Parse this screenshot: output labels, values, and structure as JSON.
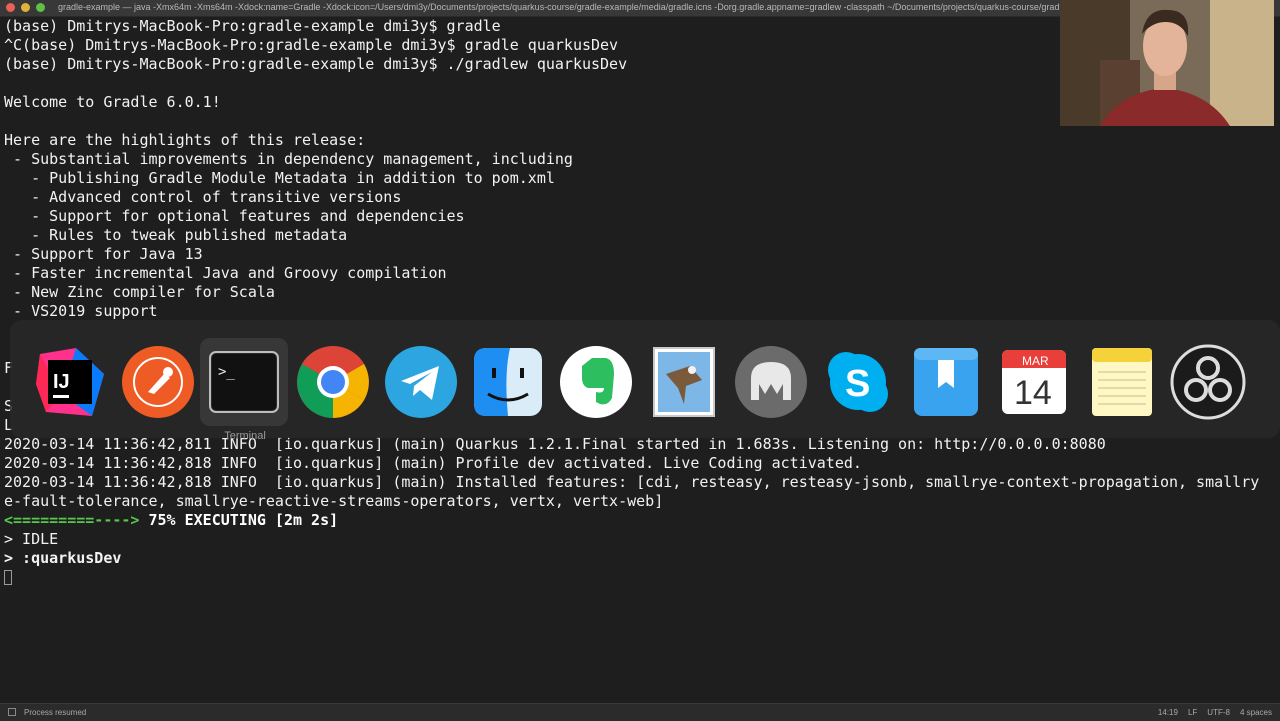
{
  "window": {
    "title": "gradle-example — java -Xmx64m -Xms64m -Xdock:name=Gradle -Xdock:icon=/Users/dmi3y/Documents/projects/quarkus-course/gradle-example/media/gradle.icns -Dorg.gradle.appname=gradlew -classpath ~/Documents/projects/quarkus-course/gradle-example/g"
  },
  "terminal": {
    "lines": [
      "(base) Dmitrys-MacBook-Pro:gradle-example dmi3y$ gradle",
      "^C(base) Dmitrys-MacBook-Pro:gradle-example dmi3y$ gradle quarkusDev",
      "(base) Dmitrys-MacBook-Pro:gradle-example dmi3y$ ./gradlew quarkusDev",
      "Welcome to Gradle 6.0.1!",
      "Here are the highlights of this release:",
      " - Substantial improvements in dependency management, including",
      "   - Publishing Gradle Module Metadata in addition to pom.xml",
      "   - Advanced control of transitive versions",
      "   - Support for optional features and dependencies",
      "   - Rules to tweak published metadata",
      " - Support for Java 13",
      " - Faster incremental Java and Groovy compilation",
      " - New Zinc compiler for Scala",
      " - VS2019 support",
      "F",
      "S",
      "L",
      "2020-03-14 11:36:42,811 INFO  [io.quarkus] (main) Quarkus 1.2.1.Final started in 1.683s. Listening on: http://0.0.0.0:8080",
      "2020-03-14 11:36:42,818 INFO  [io.quarkus] (main) Profile dev activated. Live Coding activated.",
      "2020-03-14 11:36:42,818 INFO  [io.quarkus] (main) Installed features: [cdi, resteasy, resteasy-jsonb, smallrye-context-propagation, smallry",
      "e-fault-tolerance, smallrye-reactive-streams-operators, vertx, vertx-web]"
    ],
    "progress": {
      "bar": "<=========---->",
      "text": " 75% EXECUTING [2m 2s]",
      "percent": 75
    },
    "idle_line": "> IDLE",
    "task_line": "> :quarkusDev"
  },
  "dock": {
    "tooltip": "Terminal",
    "apps": [
      {
        "name": "IntelliJ IDEA",
        "icon": "intellij-icon",
        "label": "IJ"
      },
      {
        "name": "Postman",
        "icon": "postman-icon"
      },
      {
        "name": "Terminal",
        "icon": "terminal-icon",
        "label": ">_"
      },
      {
        "name": "Google Chrome",
        "icon": "chrome-icon"
      },
      {
        "name": "Telegram",
        "icon": "telegram-icon"
      },
      {
        "name": "Finder",
        "icon": "finder-icon"
      },
      {
        "name": "Evernote",
        "icon": "evernote-icon"
      },
      {
        "name": "Mail",
        "icon": "mail-icon"
      },
      {
        "name": "Sequel Pro",
        "icon": "sequel-pro-icon"
      },
      {
        "name": "Skype",
        "icon": "skype-icon",
        "label": "S"
      },
      {
        "name": "Bookmarks",
        "icon": "bookmark-icon"
      },
      {
        "name": "Calendar",
        "icon": "calendar-icon",
        "month": "MAR",
        "day": "14"
      },
      {
        "name": "Notes",
        "icon": "notes-icon"
      },
      {
        "name": "OBS",
        "icon": "obs-icon"
      }
    ]
  },
  "statusbar": {
    "left": "Process resumed",
    "right": [
      "14:19",
      "LF",
      "UTF-8",
      "4 spaces"
    ]
  },
  "colors": {
    "terminal_bg": "#1e1e1e",
    "terminal_fg": "#f2f2f2",
    "progress_green": "#57c84d"
  }
}
